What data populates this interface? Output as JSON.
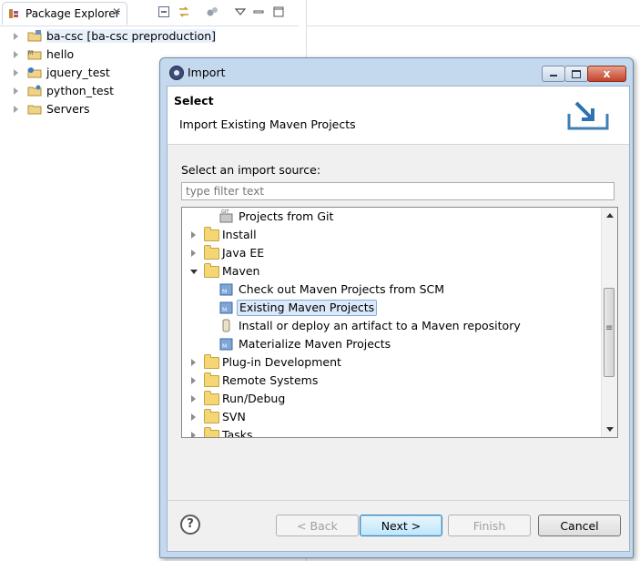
{
  "package_explorer": {
    "tab_label": "Package Explorer",
    "tab_close": "✕",
    "projects": [
      {
        "label": "ba-csc  [ba-csc preproduction]"
      },
      {
        "label": "hello"
      },
      {
        "label": "jquery_test"
      },
      {
        "label": "python_test"
      },
      {
        "label": "Servers"
      }
    ]
  },
  "dialog": {
    "title": "Import",
    "close_glyph": "x",
    "banner_title": "Select",
    "banner_description": "Import Existing Maven Projects",
    "source_label": "Select an import source:",
    "filter_placeholder": "type filter text",
    "filter_value": "",
    "tree": [
      {
        "label": "Projects from Git"
      },
      {
        "label": "Install"
      },
      {
        "label": "Java EE"
      },
      {
        "label": "Maven"
      },
      {
        "label": "Check out Maven Projects from SCM"
      },
      {
        "label": "Existing Maven Projects"
      },
      {
        "label": "Install or deploy an artifact to a Maven repository"
      },
      {
        "label": "Materialize Maven Projects"
      },
      {
        "label": "Plug-in Development"
      },
      {
        "label": "Remote Systems"
      },
      {
        "label": "Run/Debug"
      },
      {
        "label": "SVN"
      },
      {
        "label": "Tasks"
      }
    ],
    "help_glyph": "?",
    "buttons": {
      "back": "< Back",
      "next": "Next >",
      "finish": "Finish",
      "cancel": "Cancel"
    }
  }
}
